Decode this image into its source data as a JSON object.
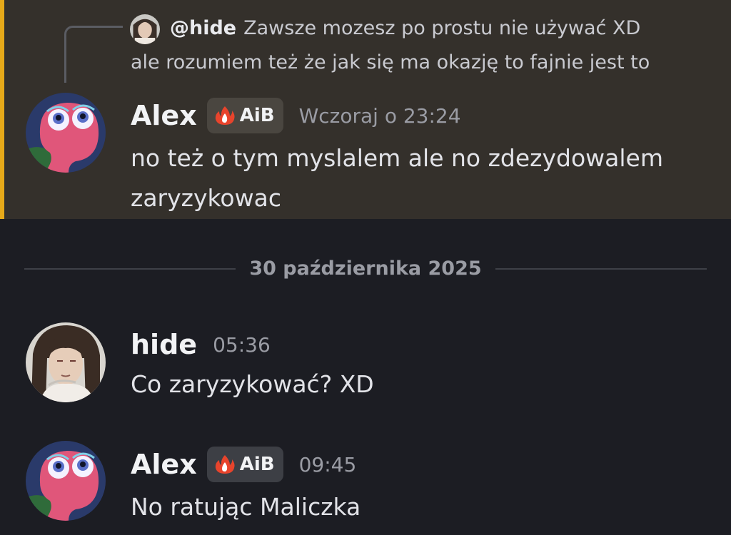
{
  "reply_preview": {
    "username": "@hide",
    "text_line1": "Zawsze mozesz po prostu nie używać XD",
    "text_line2": "ale rozumiem też że jak się ma okazję to fajnie jest to"
  },
  "messages": [
    {
      "username": "Alex",
      "tag": "AiB",
      "timestamp": "Wczoraj o 23:24",
      "lines": [
        "no też o tym myslalem ale no zdezydowalem",
        "zaryzykowac"
      ],
      "highlighted": true
    },
    {
      "username": "hide",
      "timestamp": "05:36",
      "lines": [
        "Co zaryzykować? XD"
      ],
      "highlighted": false
    },
    {
      "username": "Alex",
      "tag": "AiB",
      "timestamp": "09:45",
      "lines": [
        "No ratując Maliczka"
      ],
      "highlighted": false
    }
  ],
  "date_divider": "30 października 2025",
  "colors": {
    "background": "#1c1d23",
    "highlight_background": "#34302b",
    "highlight_bar": "#e6a919",
    "tag_flame": "#e8442c"
  },
  "icons": {
    "tag_icon": "flame-icon",
    "alex_avatar": "pink-creature-avatar",
    "hide_avatar": "drawn-character-avatar"
  }
}
